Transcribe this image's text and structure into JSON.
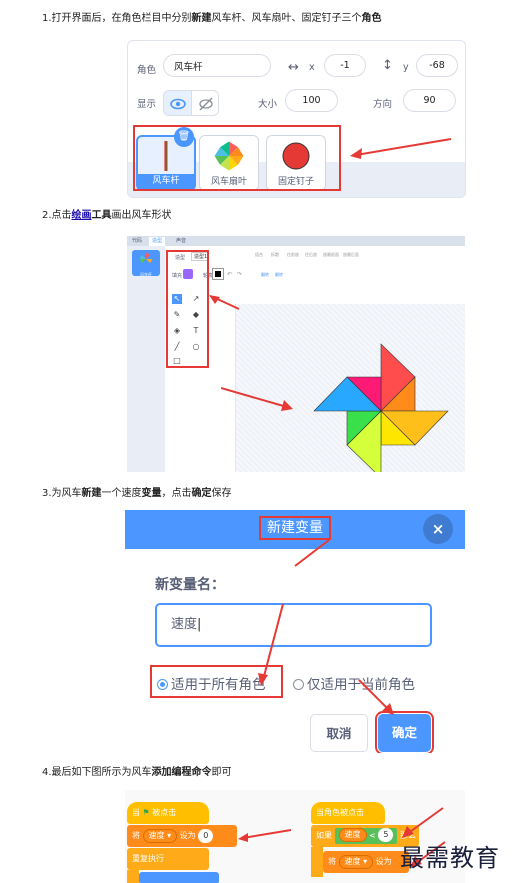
{
  "steps": [
    {
      "pre": "1.打开界面后，在角色栏目中分别",
      "bold1": "新建",
      "mid": "风车杆、风车扇叶、固定钉子三个",
      "bold2": "角色"
    },
    {
      "pre": "2.点击",
      "link": "绘画",
      "bold": "工具",
      "post": "画出风车形状"
    },
    {
      "pre": "3.为风车",
      "bold1": "新建",
      "mid1": "一个速度",
      "bold2": "变量",
      "mid2": "，点击",
      "bold3": "确定",
      "post": "保存"
    },
    {
      "pre": "4.最后如下图所示为风车",
      "bold1": "添加",
      "bold2": "编程命令",
      "post": "即可"
    }
  ],
  "sprite_info": {
    "role_label": "角色",
    "role_value": "风车杆",
    "x_label": "x",
    "x_value": "-1",
    "y_label": "y",
    "y_value": "-68",
    "show_label": "显示",
    "size_label": "大小",
    "size_value": "100",
    "direction_label": "方向",
    "direction_value": "90",
    "sprites": [
      "风车杆",
      "风车扇叶",
      "固定钉子"
    ]
  },
  "paint_editor": {
    "tabs": [
      "代码",
      "造型",
      "声音"
    ],
    "sprite_tile": "风车杆",
    "costume_label": "造型",
    "costume_name": "造型1",
    "fill_label": "填充",
    "stroke_label": "轮廓",
    "toolbar_labels": [
      "组合",
      "拆散",
      "往前放",
      "往后放",
      "放最前面",
      "放最后面",
      "翻转",
      "翻转"
    ],
    "colors": {
      "fill": "#9966ff",
      "accent": "#4c97ff"
    }
  },
  "dialog": {
    "title": "新建变量",
    "close": "×",
    "question": "新变量名：",
    "input_value": "速度",
    "option_all": "适用于所有角色",
    "option_this": "仅适用于当前角色",
    "cancel": "取消",
    "ok": "确定"
  },
  "code": {
    "left": {
      "hat_pre": "当",
      "hat_post": "被点击",
      "set": "将",
      "var": "速度",
      "to": "设为",
      "value": "0",
      "forever": "重复执行"
    },
    "right": {
      "hat": "当角色被点击",
      "if": "如果",
      "var": "速度",
      "op": "<",
      "value": "5",
      "then": "那么",
      "set": "将",
      "set_to": "设为"
    }
  },
  "watermark": "最需教育"
}
